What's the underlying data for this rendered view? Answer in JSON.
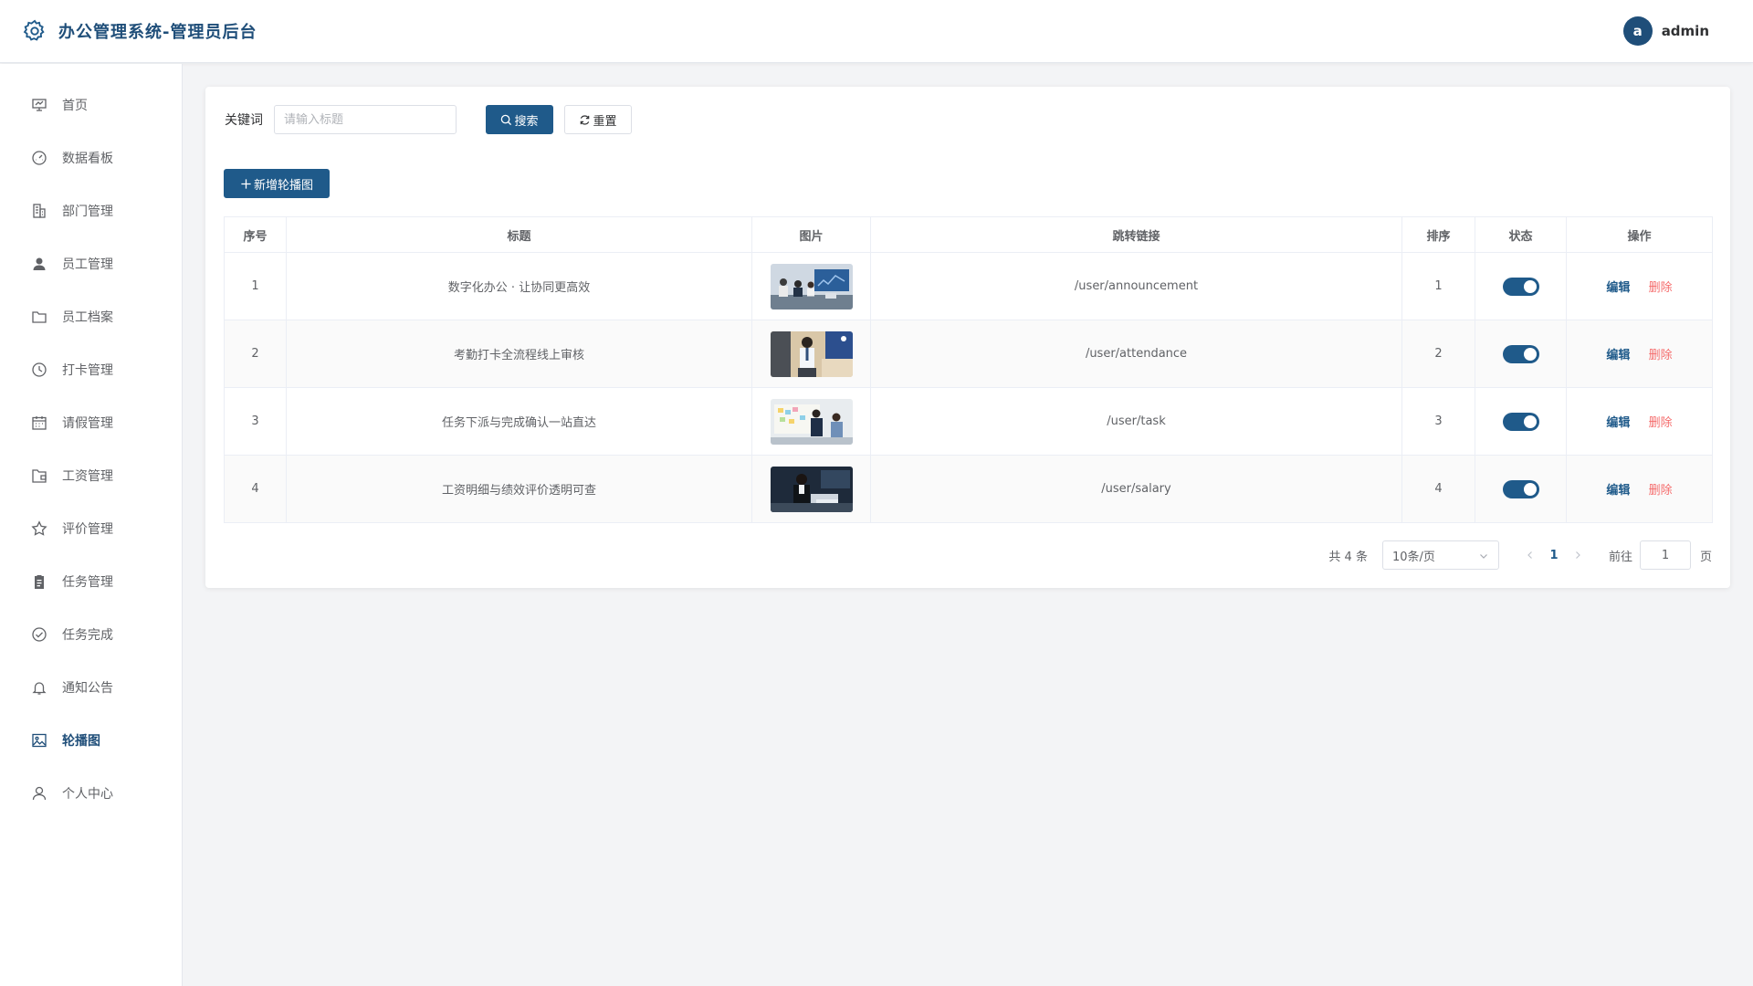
{
  "header": {
    "title": "办公管理系统-管理员后台",
    "avatar_letter": "a",
    "username": "admin"
  },
  "sidebar": {
    "items": [
      {
        "label": "首页",
        "icon": "presentation-icon"
      },
      {
        "label": "数据看板",
        "icon": "gauge-icon"
      },
      {
        "label": "部门管理",
        "icon": "building-icon"
      },
      {
        "label": "员工管理",
        "icon": "user-filled-icon"
      },
      {
        "label": "员工档案",
        "icon": "folder-icon"
      },
      {
        "label": "打卡管理",
        "icon": "clock-icon"
      },
      {
        "label": "请假管理",
        "icon": "calendar-icon"
      },
      {
        "label": "工资管理",
        "icon": "wallet-folder-icon"
      },
      {
        "label": "评价管理",
        "icon": "star-icon"
      },
      {
        "label": "任务管理",
        "icon": "clipboard-icon"
      },
      {
        "label": "任务完成",
        "icon": "check-circle-icon"
      },
      {
        "label": "通知公告",
        "icon": "bell-icon"
      },
      {
        "label": "轮播图",
        "icon": "picture-icon",
        "active": true
      },
      {
        "label": "个人中心",
        "icon": "user-outline-icon"
      }
    ]
  },
  "search": {
    "label": "关键词",
    "placeholder": "请输入标题",
    "value": "",
    "search_button": "搜索",
    "reset_button": "重置"
  },
  "toolbar": {
    "add_button": "新增轮播图"
  },
  "table": {
    "columns": [
      "序号",
      "标题",
      "图片",
      "跳转链接",
      "排序",
      "状态",
      "操作"
    ],
    "rows": [
      {
        "index": "1",
        "title": "数字化办公 · 让协同更高效",
        "link": "/user/announcement",
        "sort": "1",
        "enabled": true,
        "image": "meeting-photo"
      },
      {
        "index": "2",
        "title": "考勤打卡全流程线上审核",
        "link": "/user/attendance",
        "sort": "2",
        "enabled": true,
        "image": "office-worker-photo"
      },
      {
        "index": "3",
        "title": "任务下派与完成确认一站直达",
        "link": "/user/task",
        "sort": "3",
        "enabled": true,
        "image": "whiteboard-photo"
      },
      {
        "index": "4",
        "title": "工资明细与绩效评价透明可查",
        "link": "/user/salary",
        "sort": "4",
        "enabled": true,
        "image": "laptop-worker-photo"
      }
    ],
    "edit_label": "编辑",
    "delete_label": "删除"
  },
  "pagination": {
    "total": "共 4 条",
    "page_size": "10条/页",
    "current_page": "1",
    "goto_label": "前往",
    "goto_value": "1",
    "page_suffix": "页"
  },
  "colors": {
    "primary": "#1f5a8a",
    "danger": "#f56c6c",
    "background": "#f3f4f6"
  }
}
